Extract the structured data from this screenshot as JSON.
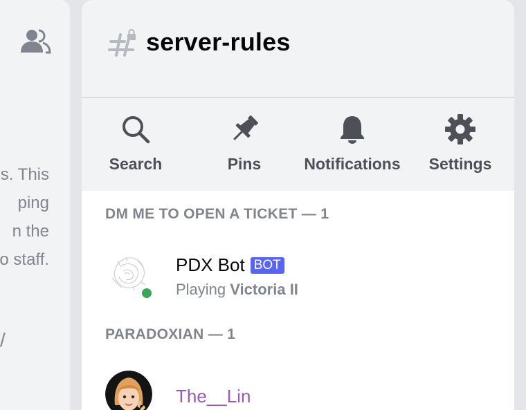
{
  "left_panel": {
    "icon": "members-icon",
    "text_lines": [
      "s. This",
      "ping",
      "n the",
      "o staff."
    ],
    "slash": "/"
  },
  "drawer": {
    "channel_icon": "locked-hashtag-icon",
    "channel_name": "server-rules",
    "actions": [
      {
        "icon": "search-icon",
        "label": "Search"
      },
      {
        "icon": "pin-icon",
        "label": "Pins"
      },
      {
        "icon": "bell-icon",
        "label": "Notifications"
      },
      {
        "icon": "gear-icon",
        "label": "Settings"
      }
    ],
    "sections": [
      {
        "title": "DM ME TO OPEN A TICKET — 1",
        "members": [
          {
            "name": "PDX Bot",
            "tag": "BOT",
            "activity_prefix": "Playing",
            "activity_game": "Victoria II",
            "status": "online",
            "status_color": "#3ba55c"
          }
        ]
      },
      {
        "title": "PARADOXIAN — 1",
        "members": [
          {
            "name": "The__Lin",
            "name_color": "#9b59b6"
          }
        ]
      }
    ]
  },
  "colors": {
    "tag_bg": "#5865f2",
    "header_bg": "#f2f3f5",
    "icon_color": "#4e5058"
  }
}
